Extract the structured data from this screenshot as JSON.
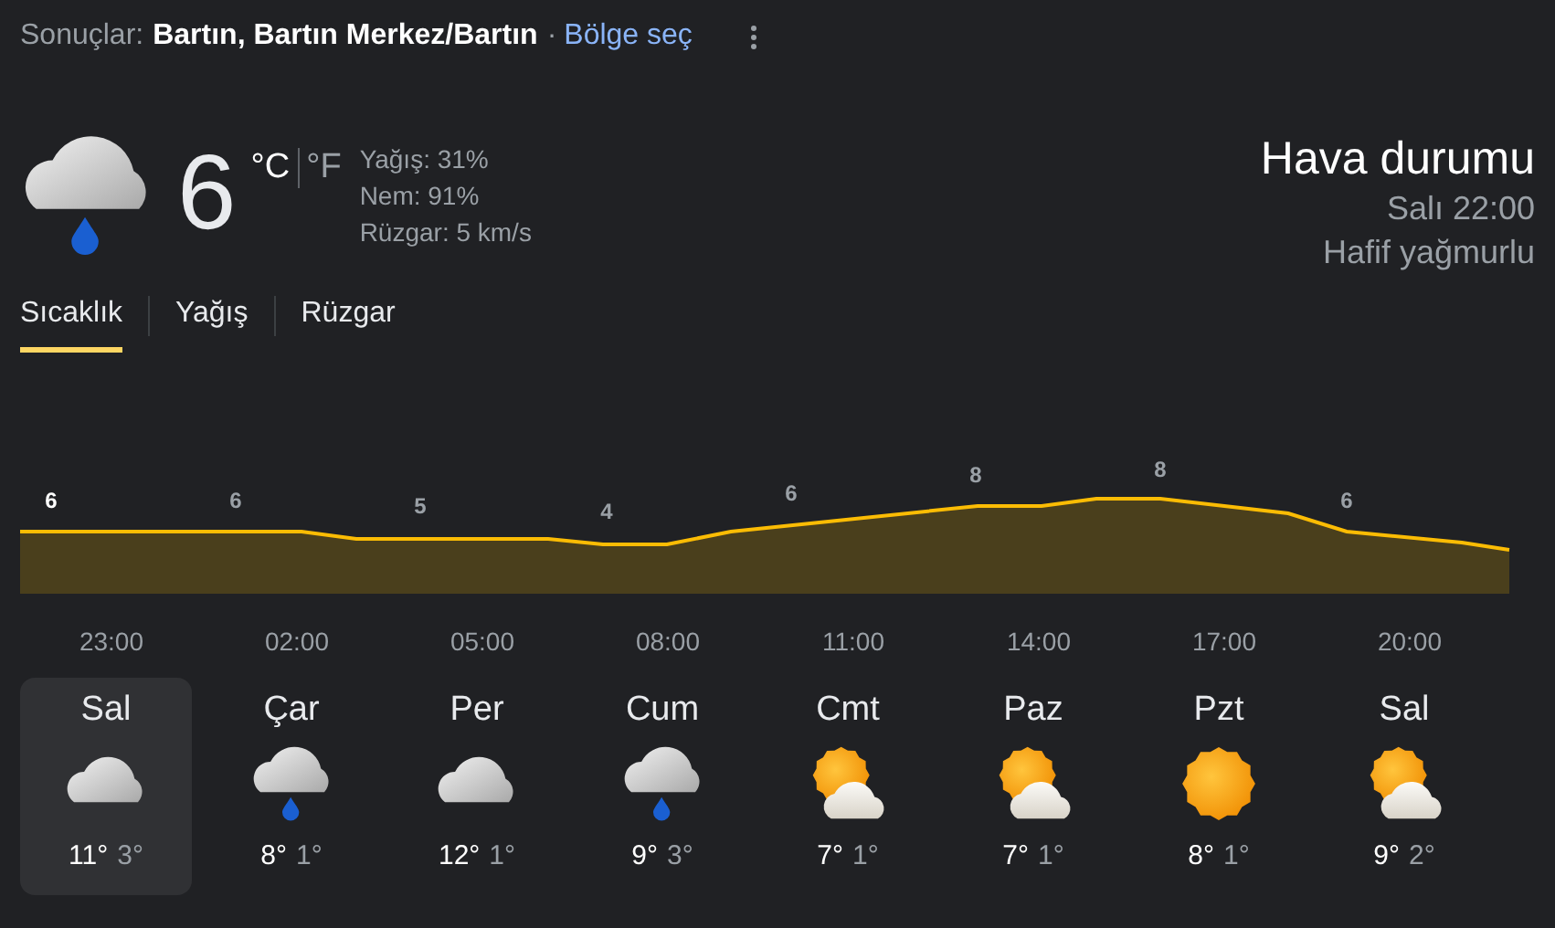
{
  "header": {
    "prefix": "Sonuçlar:",
    "location": "Bartın, Bartın Merkez/Bartın",
    "separator": "·",
    "link": "Bölge seç"
  },
  "current": {
    "kind": "rain",
    "temperature": "6",
    "unit_c": "°C",
    "unit_f": "°F",
    "unit_c_selected": true,
    "details": [
      "Yağış: 31%",
      "Nem: 91%",
      "Rüzgar: 5 km/s"
    ],
    "title": "Hava durumu",
    "time": "Salı 22:00",
    "condition": "Hafif yağmurlu"
  },
  "tabs": [
    {
      "label": "Sıcaklık",
      "selected": true
    },
    {
      "label": "Yağış",
      "selected": false
    },
    {
      "label": "Rüzgar",
      "selected": false
    }
  ],
  "temperature_graph": {
    "value_labels": [
      "6",
      "6",
      "5",
      "4",
      "6",
      "8",
      "8",
      "6"
    ],
    "times": [
      "23:00",
      "02:00",
      "05:00",
      "08:00",
      "11:00",
      "14:00",
      "17:00",
      "20:00"
    ]
  },
  "days": [
    {
      "day": "Sal",
      "kind": "cloudy",
      "high": "11°",
      "low": "3°",
      "selected": true
    },
    {
      "day": "Çar",
      "kind": "rain",
      "high": "8°",
      "low": "1°",
      "selected": false
    },
    {
      "day": "Per",
      "kind": "cloudy",
      "high": "12°",
      "low": "1°",
      "selected": false
    },
    {
      "day": "Cum",
      "kind": "rain",
      "high": "9°",
      "low": "3°",
      "selected": false
    },
    {
      "day": "Cmt",
      "kind": "partly_sunny",
      "high": "7°",
      "low": "1°",
      "selected": false
    },
    {
      "day": "Paz",
      "kind": "partly_sunny",
      "high": "7°",
      "low": "1°",
      "selected": false
    },
    {
      "day": "Pzt",
      "kind": "sunny",
      "high": "8°",
      "low": "1°",
      "selected": false
    },
    {
      "day": "Sal",
      "kind": "partly_sunny",
      "high": "9°",
      "low": "2°",
      "selected": false
    }
  ]
}
